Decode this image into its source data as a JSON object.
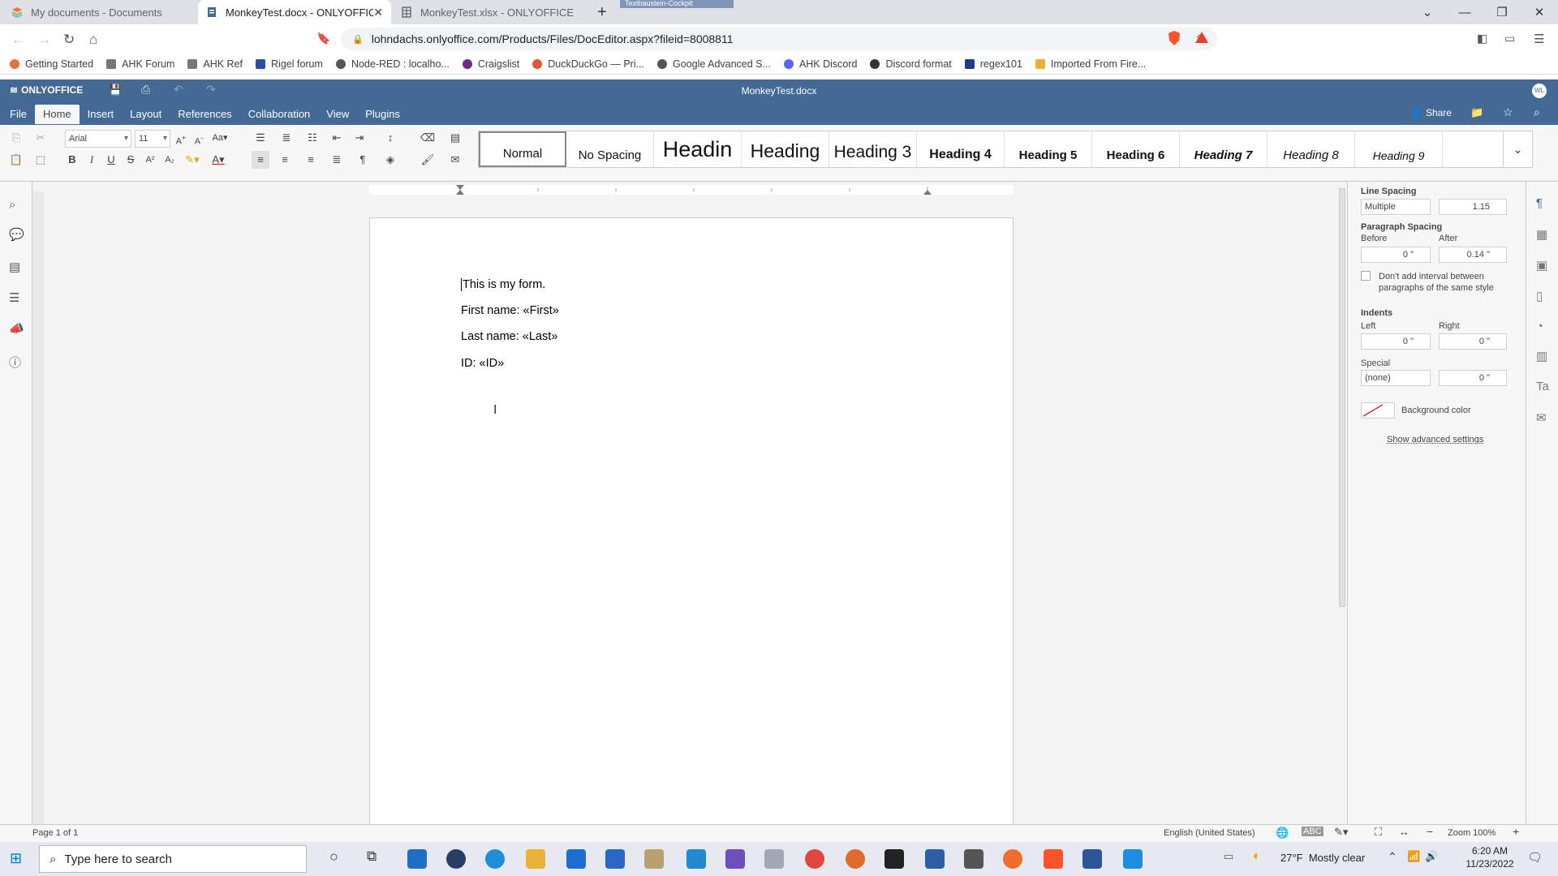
{
  "browser": {
    "tabs": [
      {
        "title": "My documents - Documents",
        "icon": "onlyoffice-icon",
        "active": false
      },
      {
        "title": "MonkeyTest.docx - ONLYOFFICE",
        "icon": "document-icon",
        "active": true
      },
      {
        "title": "MonkeyTest.xlsx - ONLYOFFICE",
        "icon": "spreadsheet-icon",
        "active": false
      }
    ],
    "floating_label": "Textbaustein-Cockpit",
    "url": "lohndachs.onlyoffice.com/Products/Files/DocEditor.aspx?fileid=8008811",
    "bookmarks": [
      {
        "label": "Getting Started",
        "color": "#e8703a"
      },
      {
        "label": "AHK Forum",
        "color": "#777777"
      },
      {
        "label": "AHK Ref",
        "color": "#777777"
      },
      {
        "label": "Rigel forum",
        "color": "#2c4fa3"
      },
      {
        "label": "Node-RED : localho...",
        "color": "#555555"
      },
      {
        "label": "Craigslist",
        "color": "#6b2a8c"
      },
      {
        "label": "DuckDuckGo — Pri...",
        "color": "#de5833"
      },
      {
        "label": "Google Advanced S...",
        "color": "#555555"
      },
      {
        "label": "AHK Discord",
        "color": "#5865f2"
      },
      {
        "label": "Discord format",
        "color": "#333333"
      },
      {
        "label": "regex101",
        "color": "#1e3a8a"
      },
      {
        "label": "Imported From Fire...",
        "color": "#e8b23a"
      }
    ]
  },
  "editor": {
    "brand": "ONLYOFFICE",
    "doc_title": "MonkeyTest.docx",
    "avatar": "WL",
    "share_label": "Share",
    "menu_tabs": [
      "File",
      "Home",
      "Insert",
      "Layout",
      "References",
      "Collaboration",
      "View",
      "Plugins"
    ],
    "active_tab": "Home",
    "font_name": "Arial",
    "font_size": "11",
    "styles": [
      "Normal",
      "No Spacing",
      "Headin",
      "Heading",
      "Heading 3",
      "Heading 4",
      "Heading 5",
      "Heading 6",
      "Heading 7",
      "Heading 8",
      "Heading 9"
    ],
    "accent": "#446995"
  },
  "document": {
    "lines": [
      "This is my form.",
      "First name: «First»",
      "Last name: «Last»",
      "ID: «ID»"
    ]
  },
  "right_panel": {
    "line_spacing_label": "Line Spacing",
    "line_spacing_type": "Multiple",
    "line_spacing_value": "1.15",
    "paragraph_spacing_label": "Paragraph Spacing",
    "before_label": "Before",
    "after_label": "After",
    "before_value": "0 \"",
    "after_value": "0.14 \"",
    "dont_add_label": "Don't add interval between paragraphs of the same style",
    "indents_label": "Indents",
    "left_label": "Left",
    "right_label": "Right",
    "left_value": "0 \"",
    "right_value": "0 \"",
    "special_label": "Special",
    "special_value": "(none)",
    "special_amount": "0 \"",
    "background_color_label": "Background color",
    "advanced_label": "Show advanced settings"
  },
  "status": {
    "page": "Page 1 of 1",
    "language": "English (United States)",
    "zoom": "Zoom 100%"
  },
  "taskbar": {
    "search_placeholder": "Type here to search",
    "weather": "27°F  Mostly clear",
    "time": "6:20 AM",
    "date": "11/23/2022"
  }
}
